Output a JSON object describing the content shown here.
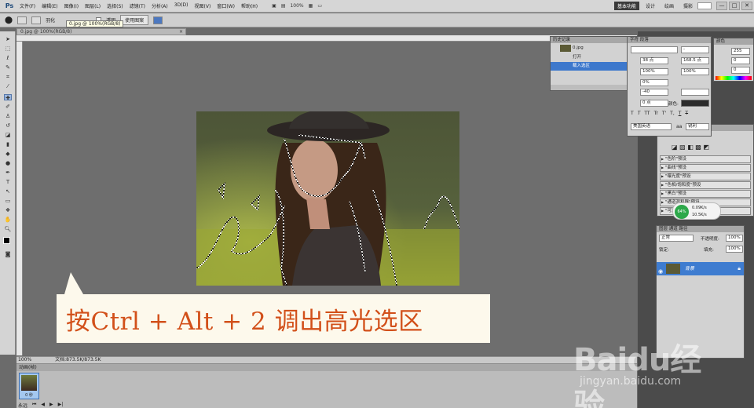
{
  "app": {
    "logo": "Ps"
  },
  "menu": [
    "文件(F)",
    "编辑(E)",
    "图像(I)",
    "图层(L)",
    "选择(S)",
    "滤镜(T)",
    "分析(A)",
    "3D(D)",
    "视图(V)",
    "窗口(W)",
    "帮助(H)"
  ],
  "menu_mini": {
    "zoom": "100%"
  },
  "workspaces": [
    "基本功能",
    "设计",
    "绘画",
    "摄影"
  ],
  "window_buttons": [
    "—",
    "□",
    "✕"
  ],
  "options_bar": {
    "feather_label": "羽化",
    "antialias_label": "消除锯齿",
    "transparent_label": "透明",
    "use_pattern_button": "使用图案"
  },
  "tooltip": "0.jpg @ 100%(RGB/8)",
  "document": {
    "tab_label": "0.jpg @ 100%(RGB/8)",
    "tab_close": "×",
    "zoom": "100%",
    "doc_info": "文档:873.5K/873.5K"
  },
  "animation_panel": {
    "tab": "动画(帧)",
    "frame_label": "0 秒",
    "loop": "永远"
  },
  "caption": {
    "text": "按Ctrl + Alt + 2 调出高光选区"
  },
  "history_panel": {
    "tabs": [
      "历史记录"
    ],
    "snapshot": "0.jpg",
    "items": [
      {
        "label": "打开",
        "selected": false
      },
      {
        "label": "载入选区",
        "selected": true
      }
    ]
  },
  "character_panel": {
    "tabs": [
      "字符",
      "段落"
    ],
    "font_style": "-",
    "size": "38 点",
    "leading": "168.5 点",
    "vscale": "100%",
    "hscale": "100%",
    "tracking_pct": "0%",
    "kerning": "-40",
    "baseline": "0 点",
    "color_label": "颜色:",
    "style_buttons": [
      "T",
      "T",
      "TT",
      "Tr",
      "T'",
      "T,",
      "T",
      "T"
    ],
    "language": "美国英语",
    "aa_symbol": "aa",
    "aa_mode": "锐利"
  },
  "color_panel": {
    "tabs": [
      "颜色",
      "色板",
      "样式"
    ],
    "values": [
      "255",
      "0",
      "0",
      "255"
    ]
  },
  "adjustments_panel": {
    "tabs": [
      "调整",
      "蒙版"
    ],
    "presets": [
      "\"色阶\"预设",
      "\"曲线\"预设",
      "\"曝光度\"预设",
      "\"色相/饱和度\"预设",
      "\"黑白\"预设",
      "\"通道混和器\"预设",
      "\"可选颜色\"预设"
    ]
  },
  "layers_panel": {
    "tabs": [
      "图层",
      "通道",
      "路径"
    ],
    "blend_mode": "正常",
    "opacity_label": "不透明度:",
    "opacity": "100%",
    "lock_label": "锁定:",
    "fill_label": "填充:",
    "fill": "100%",
    "layer_name": "背景"
  },
  "network_badge": {
    "percent": "64%",
    "up": "0.09K/s",
    "down": "10.5K/s"
  },
  "watermark": {
    "brand": "Baidu经验",
    "url": "jingyan.baidu.com"
  },
  "colors": {
    "selection_blue": "#3d78cc",
    "caption_text": "#d2501a",
    "caption_bg": "#fdf9ec"
  }
}
